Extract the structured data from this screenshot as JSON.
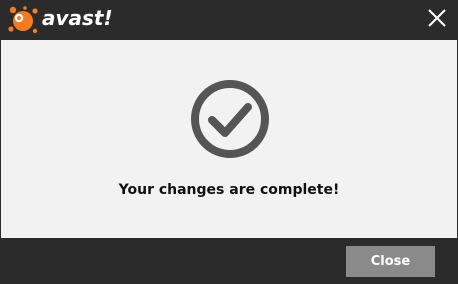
{
  "titlebar": {
    "brand": "avast!",
    "logo_icon": "avast-orange-splat-logo",
    "close_icon": "close-icon"
  },
  "content": {
    "status_icon": "check-circle-icon",
    "message": "Your changes are complete!"
  },
  "footer": {
    "close_label": "Close"
  },
  "colors": {
    "frame": "#2b2b2b",
    "content_bg": "#f2f2f2",
    "icon_gray": "#555555",
    "button_bg": "#8a8a8a",
    "brand_orange": "#f47b20"
  }
}
